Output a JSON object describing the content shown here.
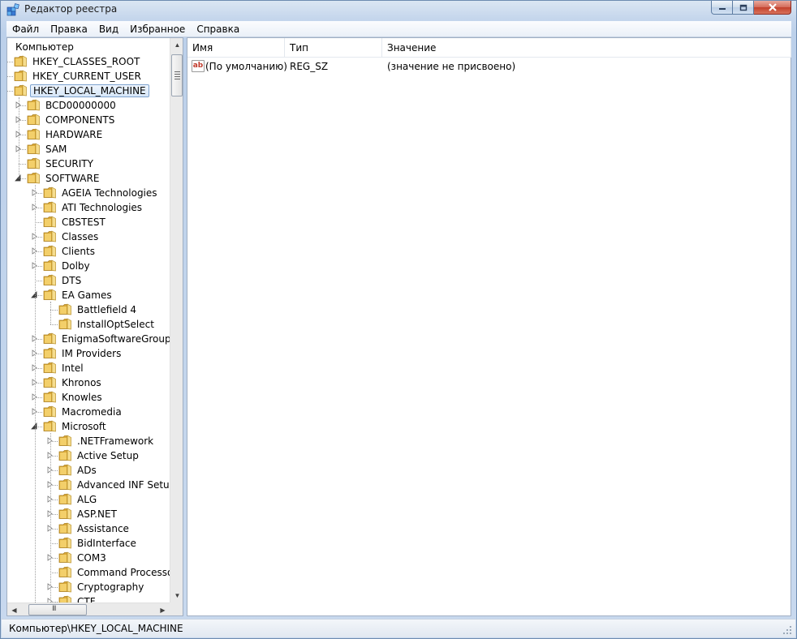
{
  "window": {
    "title": "Редактор реестра"
  },
  "menu": [
    "Файл",
    "Правка",
    "Вид",
    "Избранное",
    "Справка"
  ],
  "tree": {
    "root": "Компьютер",
    "rows": [
      {
        "label": "HKEY_CLASSES_ROOT",
        "depth": 0,
        "expander": "none"
      },
      {
        "label": "HKEY_CURRENT_USER",
        "depth": 0,
        "expander": "none"
      },
      {
        "label": "HKEY_LOCAL_MACHINE",
        "depth": 0,
        "expander": "none",
        "selected": true
      },
      {
        "label": "BCD00000000",
        "depth": 1,
        "expander": "collapsed"
      },
      {
        "label": "COMPONENTS",
        "depth": 1,
        "expander": "collapsed"
      },
      {
        "label": "HARDWARE",
        "depth": 1,
        "expander": "collapsed"
      },
      {
        "label": "SAM",
        "depth": 1,
        "expander": "collapsed"
      },
      {
        "label": "SECURITY",
        "depth": 1,
        "expander": "none"
      },
      {
        "label": "SOFTWARE",
        "depth": 1,
        "expander": "expanded"
      },
      {
        "label": "AGEIA Technologies",
        "depth": 2,
        "expander": "collapsed"
      },
      {
        "label": "ATI Technologies",
        "depth": 2,
        "expander": "collapsed"
      },
      {
        "label": "CBSTEST",
        "depth": 2,
        "expander": "none"
      },
      {
        "label": "Classes",
        "depth": 2,
        "expander": "collapsed"
      },
      {
        "label": "Clients",
        "depth": 2,
        "expander": "collapsed"
      },
      {
        "label": "Dolby",
        "depth": 2,
        "expander": "collapsed"
      },
      {
        "label": "DTS",
        "depth": 2,
        "expander": "none"
      },
      {
        "label": "EA Games",
        "depth": 2,
        "expander": "expanded"
      },
      {
        "label": "Battlefield 4",
        "depth": 3,
        "expander": "none"
      },
      {
        "label": "InstallOptSelect",
        "depth": 3,
        "expander": "none"
      },
      {
        "label": "EnigmaSoftwareGroup",
        "depth": 2,
        "expander": "collapsed"
      },
      {
        "label": "IM Providers",
        "depth": 2,
        "expander": "collapsed"
      },
      {
        "label": "Intel",
        "depth": 2,
        "expander": "collapsed"
      },
      {
        "label": "Khronos",
        "depth": 2,
        "expander": "collapsed"
      },
      {
        "label": "Knowles",
        "depth": 2,
        "expander": "collapsed"
      },
      {
        "label": "Macromedia",
        "depth": 2,
        "expander": "collapsed"
      },
      {
        "label": "Microsoft",
        "depth": 2,
        "expander": "expanded"
      },
      {
        "label": ".NETFramework",
        "depth": 3,
        "expander": "collapsed"
      },
      {
        "label": "Active Setup",
        "depth": 3,
        "expander": "collapsed"
      },
      {
        "label": "ADs",
        "depth": 3,
        "expander": "collapsed"
      },
      {
        "label": "Advanced INF Setup",
        "depth": 3,
        "expander": "collapsed"
      },
      {
        "label": "ALG",
        "depth": 3,
        "expander": "collapsed"
      },
      {
        "label": "ASP.NET",
        "depth": 3,
        "expander": "collapsed"
      },
      {
        "label": "Assistance",
        "depth": 3,
        "expander": "collapsed"
      },
      {
        "label": "BidInterface",
        "depth": 3,
        "expander": "none"
      },
      {
        "label": "COM3",
        "depth": 3,
        "expander": "collapsed"
      },
      {
        "label": "Command Processor",
        "depth": 3,
        "expander": "none"
      },
      {
        "label": "Cryptography",
        "depth": 3,
        "expander": "collapsed"
      },
      {
        "label": "CTF",
        "depth": 3,
        "expander": "collapsed"
      }
    ]
  },
  "values": {
    "columns": [
      "Имя",
      "Тип",
      "Значение"
    ],
    "rows": [
      {
        "icon": "string-value-icon",
        "icon_text": "ab",
        "name": "(По умолчанию)",
        "type": "REG_SZ",
        "data": "(значение не присвоено)"
      }
    ]
  },
  "status": {
    "path": "Компьютер\\HKEY_LOCAL_MACHINE"
  },
  "scrollbar": {
    "h_grip": "III"
  }
}
